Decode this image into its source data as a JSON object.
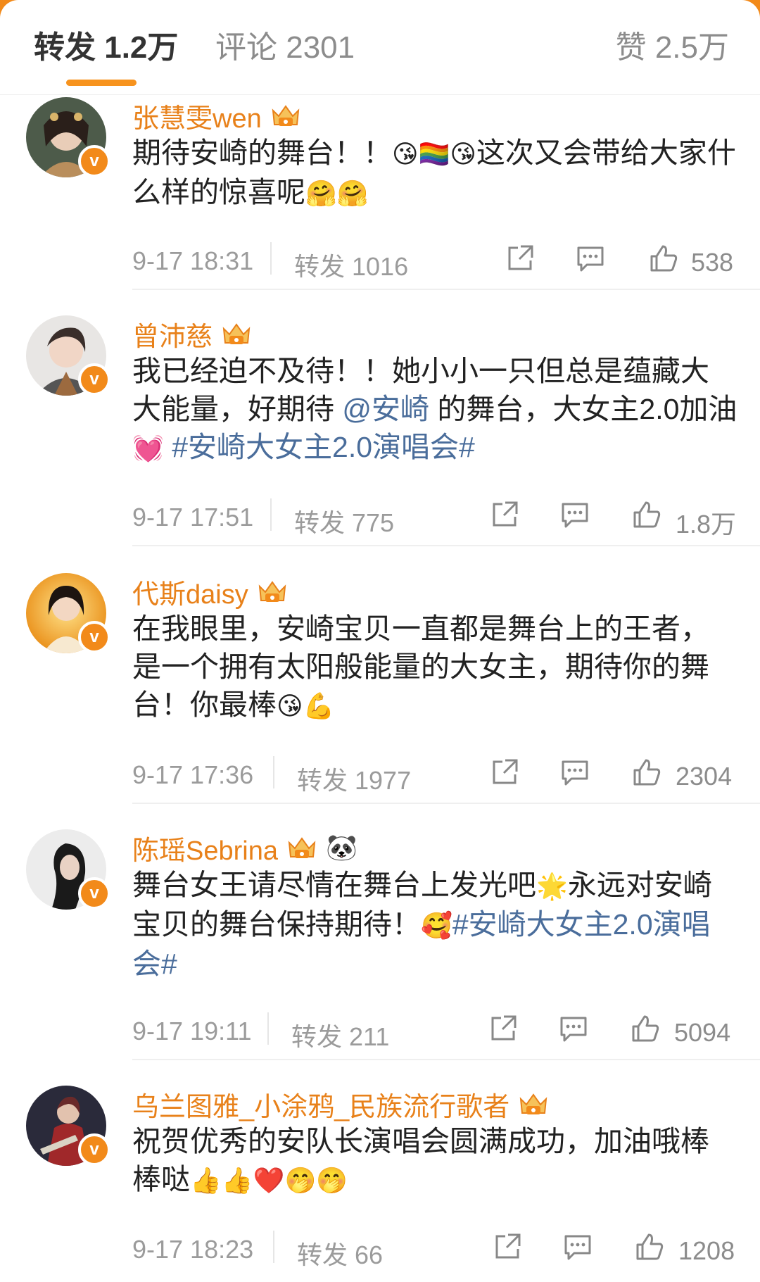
{
  "tabs": {
    "repost": "转发 1.2万",
    "comment": "评论 2301",
    "like": "赞 2.5万"
  },
  "comments": [
    {
      "name": "张慧雯wen",
      "text_before": "期待安崎的舞台！！",
      "emoji1": "😘🏳️‍🌈😘",
      "text_after": "这次又会带给大家什么样的惊喜呢",
      "emoji2": "🤗🤗",
      "time": "9-17 18:31",
      "reposts": "转发 1016",
      "likes": "538"
    },
    {
      "name": "曾沛慈",
      "text_before": "我已经迫不及待！！她小小一只但总是蕴藏大大能量，好期待 ",
      "mention": "@安崎",
      "text_mid": " 的舞台，大女主2.0加油",
      "emoji1": "💓",
      "hashtag": " #安崎大女主2.0演唱会#",
      "time": "9-17 17:51",
      "reposts": "转发 775",
      "likes": "1.8万"
    },
    {
      "name": "代斯daisy",
      "text_before": "在我眼里，安崎宝贝一直都是舞台上的王者，是一个拥有太阳般能量的大女主，期待你的舞台！你最棒",
      "emoji1": "😘💪",
      "time": "9-17 17:36",
      "reposts": "转发 1977",
      "likes": "2304"
    },
    {
      "name": "陈瑶Sebrina",
      "panda": "🐼",
      "text_before": "舞台女王请尽情在舞台上发光吧",
      "emoji1": "🌟",
      "text_mid": "永远对安崎宝贝的舞台保持期待！",
      "emoji2": "🥰",
      "hashtag": "#安崎大女主2.0演唱会#",
      "time": "9-17 19:11",
      "reposts": "转发 211",
      "likes": "5094"
    },
    {
      "name": "乌兰图雅_小涂鸦_民族流行歌者",
      "text_before": "祝贺优秀的安队长演唱会圆满成功，加油哦棒棒哒",
      "emoji1": "👍👍❤️🤭🤭",
      "time": "9-17 18:23",
      "reposts": "转发 66",
      "likes": "1208"
    }
  ],
  "badge_letter": "v",
  "colors": {
    "accent": "#f28a1a",
    "username": "#e8811a",
    "link": "#4a6d9b",
    "meta": "#9b9b9b"
  },
  "icons": [
    "repost-icon",
    "comment-icon",
    "like-icon",
    "crown-badge-icon",
    "verified-v-icon"
  ]
}
